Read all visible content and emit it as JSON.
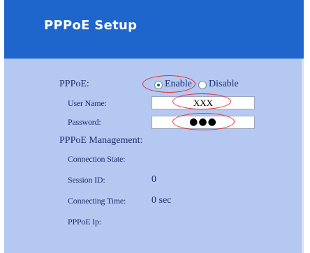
{
  "header": {
    "title": "PPPoE Setup"
  },
  "pppoe": {
    "label": "PPPoE:",
    "enable_label": "Enable",
    "disable_label": "Disable",
    "selected": "Enable"
  },
  "fields": {
    "username_label": "User Name:",
    "username_value": "XXX",
    "password_label": "Password:",
    "password_value": "●●●"
  },
  "management": {
    "heading": "PPPoE Management:",
    "connection_state_label": "Connection State:",
    "connection_state_value": "",
    "session_id_label": "Session ID:",
    "session_id_value": "0",
    "connecting_time_label": "Connecting Time:",
    "connecting_time_value": "0 sec",
    "pppoe_ip_label": "PPPoE Ip:",
    "pppoe_ip_value": ""
  },
  "colors": {
    "header_bg": "#1f66cc",
    "panel_bg": "#b5c8f2",
    "annotation": "#e1302f"
  }
}
